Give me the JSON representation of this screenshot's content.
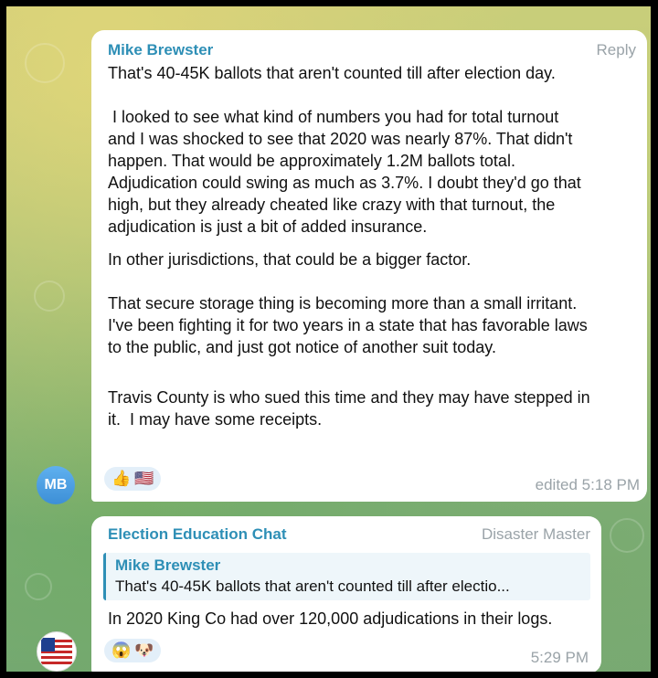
{
  "messages": [
    {
      "sender": "Mike Brewster",
      "reply_label": "Reply",
      "avatar_initials": "MB",
      "paragraphs": [
        "That's 40-45K ballots that aren't counted till after election day.",
        " I looked to see what kind of numbers you had for total turnout\nand I was shocked to see that 2020 was nearly 87%. That didn't\nhappen. That would be approximately 1.2M ballots total.\nAdjudication could swing as much as 3.7%. I doubt they'd go that\nhigh, but they already cheated like crazy with that turnout, the\nadjudication is just a bit of added insurance.",
        "In other jurisdictions, that could be a bigger factor.",
        "That secure storage thing is becoming more than a small irritant.\nI've been fighting it for two years in a state that has favorable laws\nto the public, and just got notice of another suit today.",
        "Travis County is who sued this time and they may have stepped in\nit.  I may have some receipts."
      ],
      "reactions": [
        "👍",
        "🇺🇸"
      ],
      "time": "edited 5:18 PM"
    },
    {
      "sender": "Election Education Chat",
      "author_title": "Disaster Master",
      "quote": {
        "name": "Mike Brewster",
        "text": "That's 40-45K ballots that aren't counted till after electio..."
      },
      "text": "In 2020 King Co had over 120,000 adjudications in their logs.",
      "reactions": [
        "😱",
        "🐶"
      ],
      "time": "5:29 PM"
    }
  ],
  "colors": {
    "sender": "#2e8fb6",
    "meta": "#9aa3a8",
    "avatar": "#3d8fd6",
    "reaction_bg": "#e3eff9"
  }
}
